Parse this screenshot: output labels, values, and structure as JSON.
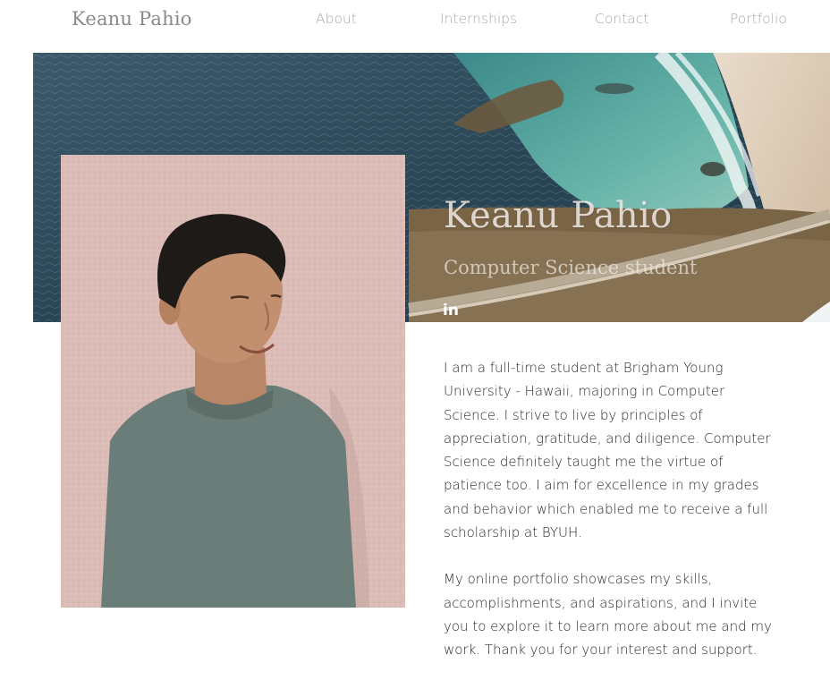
{
  "header": {
    "logo": "Keanu Pahio",
    "nav": [
      {
        "label": "About"
      },
      {
        "label": "Internships"
      },
      {
        "label": "Contact"
      },
      {
        "label": "Portfolio"
      }
    ]
  },
  "hero": {
    "name": "Keanu Pahio",
    "subtitle": "Computer Science student",
    "linkedin_label": "in"
  },
  "bio": {
    "paragraphs": [
      "I am a full-time student at Brigham Young University - Hawaii, majoring in Computer Science. I strive to live by principles of appreciation, gratitude, and diligence. Computer Science definitely taught me the virtue of patience too. I aim for excellence in my grades and behavior which enabled me to receive a full scholarship at BYUH.",
      "My online portfolio showcases my skills, accomplishments, and aspirations, and I invite you to explore it to learn more about me and my work. Thank you for your interest and support."
    ]
  },
  "icons": {
    "linkedin": "linkedin-icon"
  },
  "colors": {
    "logo": "#8a8a86",
    "nav": "#a9a9a5",
    "body_text": "#2b2b2b",
    "portrait_wall": "#dcbcb7",
    "shirt": "#6b7d78",
    "ocean_deep": "#2c4a5c",
    "lagoon": "#5fb3a6"
  }
}
